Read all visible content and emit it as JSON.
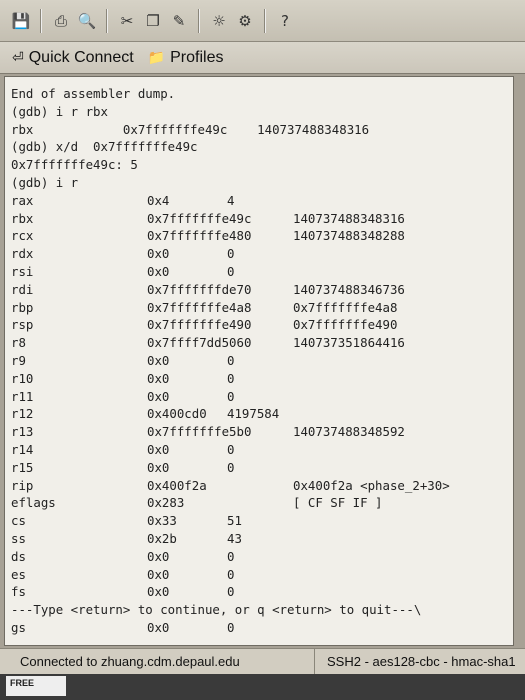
{
  "toolbar": {
    "icons": [
      "save-icon",
      "print-icon",
      "print-preview-icon",
      "cut-icon",
      "copy-icon",
      "paste-icon",
      "find-icon",
      "settings-icon",
      "help-icon"
    ]
  },
  "quick_bar": {
    "quick_connect_label": "Quick Connect",
    "profiles_label": "Profiles"
  },
  "terminal": {
    "lines": [
      "End of assembler dump.",
      "(gdb) i r rbx",
      "rbx            0x7fffffffe49c    140737488348316",
      "(gdb) x/d  0x7fffffffe49c",
      "0x7fffffffe49c: 5",
      "(gdb) i r"
    ],
    "registers": [
      {
        "name": "rax",
        "hex": "0x4",
        "dec": "4"
      },
      {
        "name": "rbx",
        "hex": "0x7fffffffe49c",
        "dec": "140737488348316"
      },
      {
        "name": "rcx",
        "hex": "0x7fffffffe480",
        "dec": "140737488348288"
      },
      {
        "name": "rdx",
        "hex": "0x0",
        "dec": "0"
      },
      {
        "name": "rsi",
        "hex": "0x0",
        "dec": "0"
      },
      {
        "name": "rdi",
        "hex": "0x7fffffffde70",
        "dec": "140737488346736"
      },
      {
        "name": "rbp",
        "hex": "0x7fffffffe4a8",
        "dec": "0x7fffffffe4a8"
      },
      {
        "name": "rsp",
        "hex": "0x7fffffffe490",
        "dec": "0x7fffffffe490"
      },
      {
        "name": "r8",
        "hex": "0x7ffff7dd5060",
        "dec": "140737351864416"
      },
      {
        "name": "r9",
        "hex": "0x0",
        "dec": "0"
      },
      {
        "name": "r10",
        "hex": "0x0",
        "dec": "0"
      },
      {
        "name": "r11",
        "hex": "0x0",
        "dec": "0"
      },
      {
        "name": "r12",
        "hex": "0x400cd0",
        "dec": "4197584"
      },
      {
        "name": "r13",
        "hex": "0x7fffffffe5b0",
        "dec": "140737488348592"
      },
      {
        "name": "r14",
        "hex": "0x0",
        "dec": "0"
      },
      {
        "name": "r15",
        "hex": "0x0",
        "dec": "0"
      },
      {
        "name": "rip",
        "hex": "0x400f2a",
        "dec": "0x400f2a <phase_2+30>"
      },
      {
        "name": "eflags",
        "hex": "0x283",
        "dec": "[ CF SF IF ]"
      },
      {
        "name": "cs",
        "hex": "0x33",
        "dec": "51"
      },
      {
        "name": "ss",
        "hex": "0x2b",
        "dec": "43"
      },
      {
        "name": "ds",
        "hex": "0x0",
        "dec": "0"
      },
      {
        "name": "es",
        "hex": "0x0",
        "dec": "0"
      },
      {
        "name": "fs",
        "hex": "0x0",
        "dec": "0"
      }
    ],
    "pager_line": "---Type <return> to continue, or q <return> to quit---\\",
    "last_register": {
      "name": "gs",
      "hex": "0x0",
      "dec": "0"
    }
  },
  "status": {
    "connection": "Connected to zhuang.cdm.depaul.edu",
    "encryption": "SSH2 - aes128-cbc - hmac-sha1"
  },
  "taskbar": {
    "badge_text": "FREE"
  }
}
